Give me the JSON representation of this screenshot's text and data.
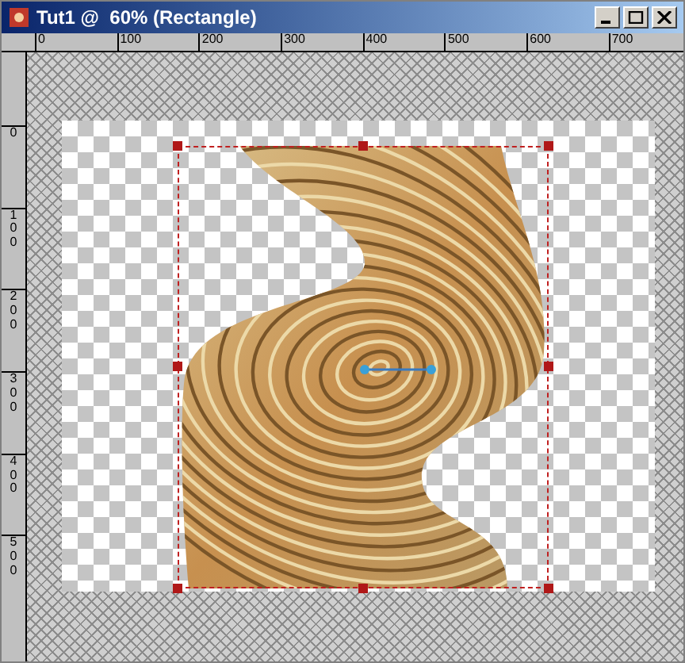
{
  "window": {
    "title": "Tut1 @  60% (Rectangle)"
  },
  "ruler_top": {
    "labels": [
      "0",
      "100",
      "200",
      "300",
      "400",
      "500",
      "600",
      "700"
    ]
  },
  "ruler_left": {
    "labels": [
      "0",
      "100",
      "200",
      "300",
      "400",
      "500"
    ]
  }
}
